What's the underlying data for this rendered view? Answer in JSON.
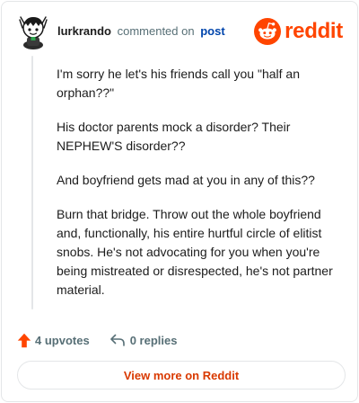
{
  "header": {
    "username": "lurkrando",
    "action_text": "commented on",
    "post_link": "post",
    "logo_text": "reddit"
  },
  "comment": {
    "paragraphs": [
      "I'm sorry he let's his friends call you \"half an orphan??\"",
      "His doctor parents mock a disorder? Their NEPHEW'S disorder??",
      "And boyfriend gets mad at you in any of this??",
      "Burn that bridge. Throw out the whole boyfriend and, functionally, his entire hurtful circle of elitist snobs. He's not advocating for you when you're being mistreated or disrespected, he's not partner material."
    ]
  },
  "footer": {
    "upvotes_label": "4 upvotes",
    "replies_label": "0 replies"
  },
  "cta": {
    "label": "View more on Reddit"
  },
  "colors": {
    "brand": "#ff4500",
    "upvote": "#ff4500",
    "link": "#0045ac",
    "cta_text": "#d93900",
    "meta": "#576f76"
  },
  "icons": {
    "avatar": "snoo-avatar",
    "logo": "reddit-alien-icon",
    "upvote": "upvote-arrow-icon",
    "reply": "reply-arrow-icon"
  }
}
